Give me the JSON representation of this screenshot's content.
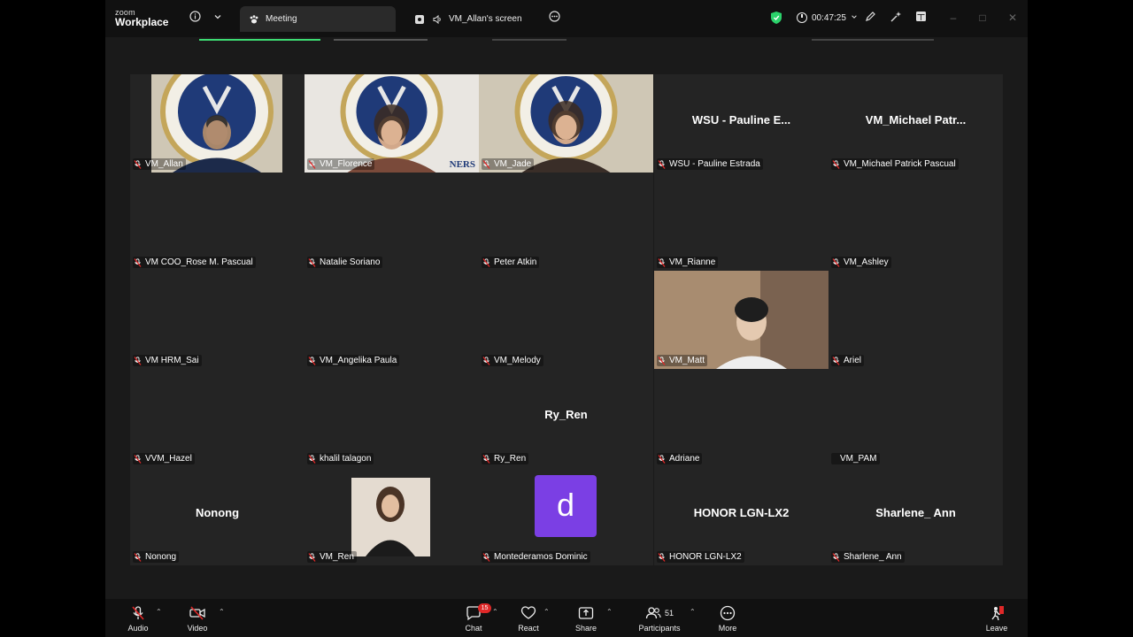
{
  "app": {
    "brand_small": "zoom",
    "brand_big": "Workplace",
    "tab_meeting": "Meeting",
    "tab_screen": "VM_Allan's screen",
    "timer": "00:47:25"
  },
  "participants": [
    {
      "name": "VM_Allan",
      "display": ""
    },
    {
      "name": "VM_Florence",
      "display": ""
    },
    {
      "name": "VM_Jade",
      "display": ""
    },
    {
      "name": "WSU - Pauline Estrada",
      "display": "WSU - Pauline E..."
    },
    {
      "name": "VM_Michael Patrick Pascual",
      "display": "VM_Michael Patr..."
    },
    {
      "name": "VM COO_Rose M. Pascual",
      "display": ""
    },
    {
      "name": "Natalie Soriano",
      "display": ""
    },
    {
      "name": "Peter Atkin",
      "display": ""
    },
    {
      "name": "VM_Rianne",
      "display": ""
    },
    {
      "name": "VM_Ashley",
      "display": ""
    },
    {
      "name": "VM HRM_Sai",
      "display": ""
    },
    {
      "name": "VM_Angelika Paula",
      "display": ""
    },
    {
      "name": "VM_Melody",
      "display": ""
    },
    {
      "name": "VM_Matt",
      "display": ""
    },
    {
      "name": "Ariel",
      "display": ""
    },
    {
      "name": "VVM_Hazel",
      "display": ""
    },
    {
      "name": "khalil talagon",
      "display": ""
    },
    {
      "name": "Ry_Ren",
      "display": "Ry_Ren"
    },
    {
      "name": "Adriane",
      "display": ""
    },
    {
      "name": "VM_PAM",
      "display": ""
    },
    {
      "name": "Nonong",
      "display": "Nonong"
    },
    {
      "name": "VM_Ren",
      "display": ""
    },
    {
      "name": "Montederamos Dominic",
      "display": "d"
    },
    {
      "name": "HONOR LGN-LX2",
      "display": "HONOR LGN-LX2"
    },
    {
      "name": "Sharlene_ Ann",
      "display": "Sharlene_ Ann"
    }
  ],
  "emblem_text": "NERS",
  "toolbar": {
    "audio": "Audio",
    "video": "Video",
    "chat": "Chat",
    "chat_badge": "15",
    "react": "React",
    "share": "Share",
    "participants": "Participants",
    "participants_count": "51",
    "more": "More",
    "leave": "Leave"
  },
  "colors": {
    "accent_green": "#3ddc73",
    "avatar_purple": "#7b3fe4",
    "mute_red": "#e02828",
    "shield_green": "#2bd26b"
  },
  "icons": [
    "info-icon",
    "chevron-down-icon",
    "paw-icon",
    "screen-share-icon",
    "speaker-icon",
    "more-circle-icon",
    "shield-check-icon",
    "clock-icon",
    "pencil-icon",
    "sparkle-icon",
    "grid-view-icon",
    "mic-muted-icon",
    "video-off-icon",
    "chat-icon",
    "react-heart-icon",
    "share-upload-icon",
    "participants-icon",
    "more-icon",
    "leave-icon"
  ]
}
